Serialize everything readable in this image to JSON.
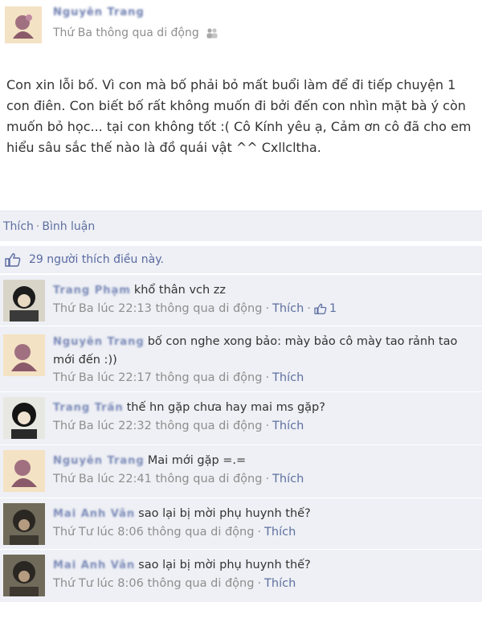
{
  "post": {
    "author": "Nguyễn Trang",
    "meta_time": "Thứ Ba thông qua di động",
    "privacy_icon": "people-icon",
    "text": "Con xin lỗi bố. Vì con mà bố phải bỏ mất buổi làm để đi tiếp chuyện 1 con điên. Con biết bố rất không muốn đi bởi đến con nhìn mặt bà ý còn muốn bỏ học... tại con không tốt :( Cô Kính yêu ạ, Cảm ơn cô đã cho em hiểu sâu sắc thế nào là đồ quái vật ^^ Cxllcltha."
  },
  "actions": {
    "like": "Thích",
    "separator": "·",
    "comment": "Bình luận"
  },
  "likes": {
    "text": "29 người thích điều này."
  },
  "comments": [
    {
      "name": "Trang Phạm",
      "text": "khổ thân vch zz",
      "time": "Thứ Ba lúc 22:13 thông qua di động",
      "like": "Thích",
      "like_count": "1"
    },
    {
      "name": "Nguyễn Trang",
      "text": "bố con nghe xong bảo: mày bảo cô mày tao rảnh tao mới đến :))",
      "time": "Thứ Ba lúc 22:17 thông qua di động",
      "like": "Thích"
    },
    {
      "name": "Trang Trần",
      "text": "thế hn gặp chưa hay mai ms gặp?",
      "time": "Thứ Ba lúc 22:32 thông qua di động",
      "like": "Thích"
    },
    {
      "name": "Nguyễn Trang",
      "text": "Mai mới gặp =.=",
      "time": "Thứ Ba lúc 22:41 thông qua di động",
      "like": "Thích"
    },
    {
      "name": "Mai Anh Vân",
      "text": "sao lại bị mời phụ huynh thế?",
      "time": "Thứ Tư lúc 8:06 thông qua di động",
      "like": "Thích"
    },
    {
      "name": "Mai Anh Vân",
      "text": "sao lại bị mời phụ huynh thế?",
      "time": "Thứ Tư lúc 8:06 thông qua di động",
      "like": "Thích"
    }
  ],
  "colors": {
    "link": "#5f6f9f",
    "panel": "#eef0f5",
    "meta": "#8e8e8e"
  }
}
